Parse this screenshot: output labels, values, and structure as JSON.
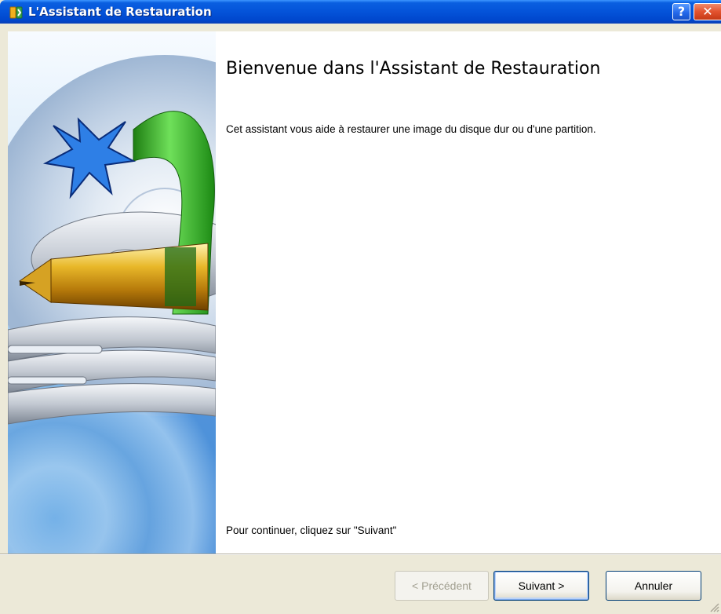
{
  "window": {
    "title": "L'Assistant de Restauration",
    "help_label": "?",
    "close_label": "✕"
  },
  "content": {
    "heading": "Bienvenue dans l'Assistant de Restauration",
    "description": "Cet assistant vous aide à restaurer une image du disque dur ou d'une partition.",
    "hint": "Pour continuer, cliquez sur \"Suivant\""
  },
  "buttons": {
    "previous": {
      "label": "< Précédent",
      "enabled": false
    },
    "next": {
      "label": "Suivant >",
      "enabled": true,
      "default": true
    },
    "cancel": {
      "label": "Annuler",
      "enabled": true
    }
  },
  "colors": {
    "titlebar": "#0453d9",
    "dialog_bg": "#ece9d8",
    "content_bg": "#ffffff",
    "ribbon_green": "#3cbc2a",
    "pen_gold": "#d9a21c"
  },
  "icons": {
    "app": "restore-wizard-app-icon",
    "help": "help-icon",
    "close": "close-icon",
    "side_image": "hard-disk-restore-illustration"
  }
}
